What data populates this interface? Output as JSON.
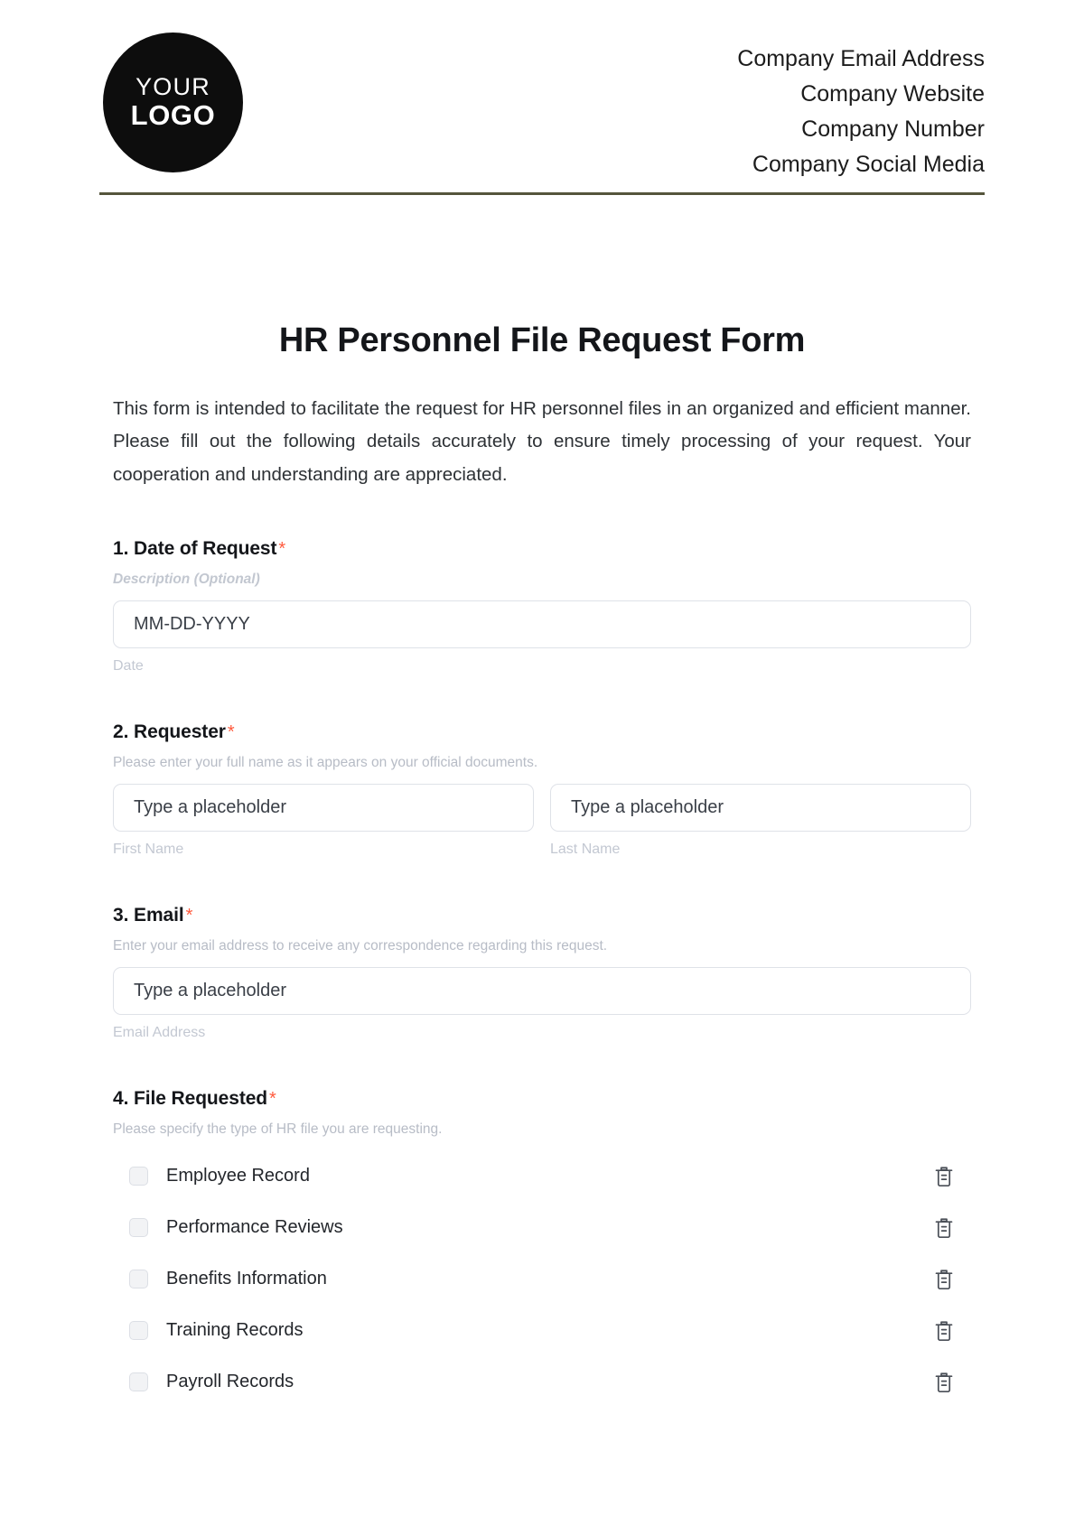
{
  "header": {
    "logo": {
      "line1": "YOUR",
      "line2": "LOGO"
    },
    "company_lines": [
      "Company Email Address",
      "Company Website",
      "Company Number",
      "Company Social Media"
    ],
    "rule_color": "#55553c"
  },
  "document": {
    "title": "HR Personnel File Request Form",
    "intro": "This form is intended to facilitate the request for HR personnel files in an organized and efficient manner. Please fill out the following details accurately to ensure timely processing of your request. Your cooperation and understanding are appreciated.",
    "required_marker": "*",
    "required_color": "#ff5a3d"
  },
  "questions": [
    {
      "title": "1. Date of Request",
      "description": "Description (Optional)",
      "description_style": "italic",
      "fields": [
        {
          "placeholder": "MM-DD-YYYY",
          "sub_label": "Date"
        }
      ]
    },
    {
      "title": "2. Requester",
      "description": "Please enter your full name as it appears on your official documents.",
      "description_style": "normal",
      "fields": [
        {
          "placeholder": "Type a placeholder",
          "sub_label": "First Name"
        },
        {
          "placeholder": "Type a placeholder",
          "sub_label": "Last Name"
        }
      ]
    },
    {
      "title": "3. Email",
      "description": "Enter your email address to receive any correspondence regarding this request.",
      "description_style": "normal",
      "fields": [
        {
          "placeholder": "Type a placeholder",
          "sub_label": "Email Address"
        }
      ]
    },
    {
      "title": "4. File Requested",
      "description": "Please specify the type of HR file you are requesting.",
      "description_style": "normal",
      "options": [
        {
          "label": "Employee Record",
          "checked": false,
          "delete_icon": "trash-icon"
        },
        {
          "label": "Performance Reviews",
          "checked": false,
          "delete_icon": "trash-icon"
        },
        {
          "label": "Benefits Information",
          "checked": false,
          "delete_icon": "trash-icon"
        },
        {
          "label": "Training Records",
          "checked": false,
          "delete_icon": "trash-icon"
        },
        {
          "label": "Payroll Records",
          "checked": false,
          "delete_icon": "trash-icon"
        }
      ]
    }
  ]
}
